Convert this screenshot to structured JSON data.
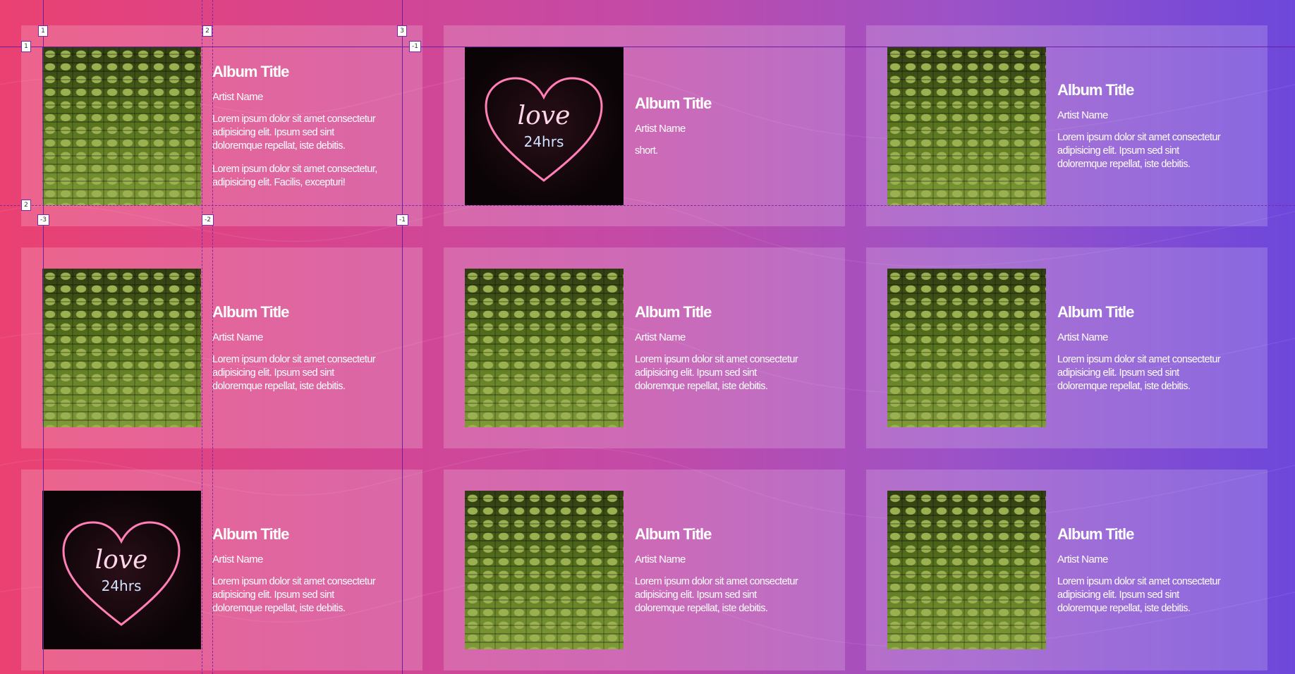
{
  "cards": [
    {
      "image": "stadium-seats",
      "title": "Album Title",
      "artist": "Artist Name",
      "desc1": "Lorem ipsum dolor sit amet consectetur adipisicing elit. Ipsum sed sint doloremque repellat, iste debitis.",
      "desc2": "Lorem ipsum dolor sit amet consectetur, adipisicing elit. Facilis, excepturi!"
    },
    {
      "image": "neon-love-sign",
      "title": "Album Title",
      "artist": "Artist Name",
      "desc1": "short."
    },
    {
      "image": "stadium-seats",
      "title": "Album Title",
      "artist": "Artist Name",
      "desc1": "Lorem ipsum dolor sit amet consectetur adipisicing elit. Ipsum sed sint doloremque repellat, iste debitis."
    },
    {
      "image": "stadium-seats",
      "title": "Album Title",
      "artist": "Artist Name",
      "desc1": "Lorem ipsum dolor sit amet consectetur adipisicing elit. Ipsum sed sint doloremque repellat, iste debitis."
    },
    {
      "image": "stadium-seats",
      "title": "Album Title",
      "artist": "Artist Name",
      "desc1": "Lorem ipsum dolor sit amet consectetur adipisicing elit. Ipsum sed sint doloremque repellat, iste debitis."
    },
    {
      "image": "stadium-seats",
      "title": "Album Title",
      "artist": "Artist Name",
      "desc1": "Lorem ipsum dolor sit amet consectetur adipisicing elit. Ipsum sed sint doloremque repellat, iste debitis."
    },
    {
      "image": "neon-love-sign",
      "title": "Album Title",
      "artist": "Artist Name",
      "desc1": "Lorem ipsum dolor sit amet consectetur adipisicing elit. Ipsum sed sint doloremque repellat, iste debitis."
    },
    {
      "image": "stadium-seats",
      "title": "Album Title",
      "artist": "Artist Name",
      "desc1": "Lorem ipsum dolor sit amet consectetur adipisicing elit. Ipsum sed sint doloremque repellat, iste debitis."
    },
    {
      "image": "stadium-seats",
      "title": "Album Title",
      "artist": "Artist Name",
      "desc1": "Lorem ipsum dolor sit amet consectetur adipisicing elit. Ipsum sed sint doloremque repellat, iste debitis."
    }
  ],
  "neon": {
    "line1": "love",
    "line2": "24hrs"
  },
  "grid_overlay": {
    "column_labels": [
      "1",
      "2",
      "3"
    ],
    "column_labels_negative": [
      "-3",
      "-2",
      "-1"
    ],
    "row_labels": [
      "1",
      "2"
    ],
    "row_labels_negative": [
      "-1"
    ]
  },
  "colors": {
    "gradient_start": "#ea4172",
    "gradient_end": "#6d47db",
    "overlay_line": "#6b1fa0"
  }
}
